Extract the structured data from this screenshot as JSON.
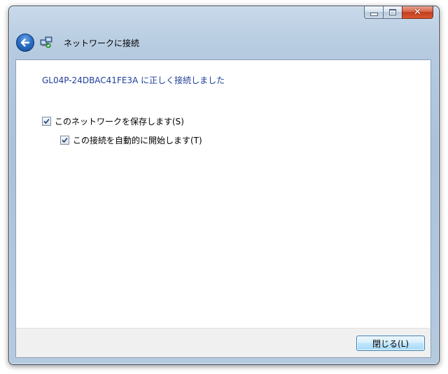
{
  "window": {
    "controls": {
      "minimize_icon": "minimize-icon",
      "maximize_icon": "maximize-icon",
      "close_icon": "close-icon",
      "close_glyph": "✕"
    }
  },
  "header": {
    "back_icon": "back-arrow-icon",
    "network_icon": "network-connection-icon",
    "title": "ネットワークに接続"
  },
  "main": {
    "success_message": "GL04P-24DBAC41FE3A に正しく接続しました",
    "options": [
      {
        "label": "このネットワークを保存します(S)",
        "checked": true
      },
      {
        "label": "この接続を自動的に開始します(T)",
        "checked": true
      }
    ]
  },
  "footer": {
    "close_button_label": "閉じる(L)"
  },
  "colors": {
    "message_text": "#1e3e9a",
    "frame": "#b6cbe0",
    "button_accent": "#3c7fb1"
  }
}
